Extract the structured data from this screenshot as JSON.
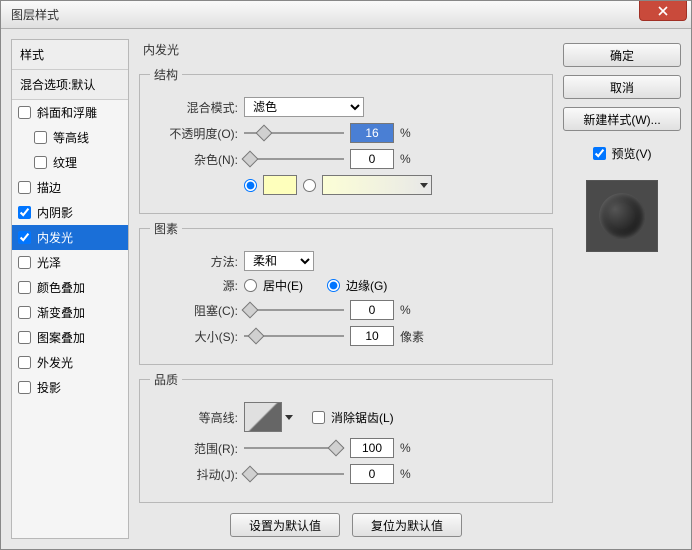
{
  "window": {
    "title": "图层样式"
  },
  "sidebar": {
    "head": "样式",
    "blend": "混合选项:默认",
    "items": [
      {
        "label": "斜面和浮雕",
        "checked": false,
        "indent": false
      },
      {
        "label": "等高线",
        "checked": false,
        "indent": true
      },
      {
        "label": "纹理",
        "checked": false,
        "indent": true
      },
      {
        "label": "描边",
        "checked": false,
        "indent": false
      },
      {
        "label": "内阴影",
        "checked": true,
        "indent": false
      },
      {
        "label": "内发光",
        "checked": true,
        "indent": false,
        "selected": true
      },
      {
        "label": "光泽",
        "checked": false,
        "indent": false
      },
      {
        "label": "颜色叠加",
        "checked": false,
        "indent": false
      },
      {
        "label": "渐变叠加",
        "checked": false,
        "indent": false
      },
      {
        "label": "图案叠加",
        "checked": false,
        "indent": false
      },
      {
        "label": "外发光",
        "checked": false,
        "indent": false
      },
      {
        "label": "投影",
        "checked": false,
        "indent": false
      }
    ]
  },
  "panel": {
    "title": "内发光",
    "structure": {
      "legend": "结构",
      "blend_mode_label": "混合模式:",
      "blend_mode_value": "滤色",
      "opacity_label": "不透明度(O):",
      "opacity_value": "16",
      "opacity_unit": "%",
      "noise_label": "杂色(N):",
      "noise_value": "0",
      "noise_unit": "%",
      "color_swatch": "#feffbc",
      "gradient_from": "#fcfed6"
    },
    "elements": {
      "legend": "图素",
      "method_label": "方法:",
      "method_value": "柔和",
      "source_label": "源:",
      "source_center": "居中(E)",
      "source_edge": "边缘(G)",
      "choke_label": "阻塞(C):",
      "choke_value": "0",
      "choke_unit": "%",
      "size_label": "大小(S):",
      "size_value": "10",
      "size_unit": "像素"
    },
    "quality": {
      "legend": "品质",
      "contour_label": "等高线:",
      "antialias_label": "消除锯齿(L)",
      "range_label": "范围(R):",
      "range_value": "100",
      "range_unit": "%",
      "jitter_label": "抖动(J):",
      "jitter_value": "0",
      "jitter_unit": "%"
    },
    "defaults": {
      "set": "设置为默认值",
      "reset": "复位为默认值"
    }
  },
  "right": {
    "ok": "确定",
    "cancel": "取消",
    "new_style": "新建样式(W)...",
    "preview": "预览(V)"
  }
}
